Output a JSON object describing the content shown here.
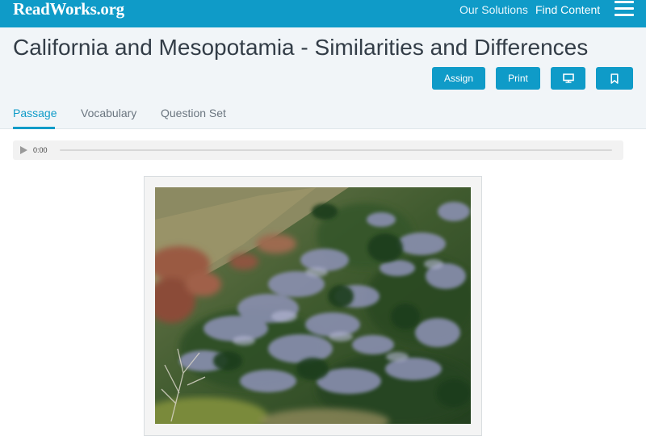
{
  "brand": {
    "logo": "ReadWorks.org"
  },
  "nav": {
    "our_solutions": "Our Solutions",
    "find_content": "Find Content"
  },
  "article": {
    "title": "California and Mesopotamia - Similarities and Differences"
  },
  "actions": {
    "assign": "Assign",
    "print": "Print",
    "present_icon": "monitor-icon",
    "bookmark_icon": "bookmark-icon"
  },
  "tabs": [
    {
      "label": "Passage",
      "active": true
    },
    {
      "label": "Vocabulary",
      "active": false
    },
    {
      "label": "Question Set",
      "active": false
    }
  ],
  "audio": {
    "time": "0:00",
    "progress": 0
  },
  "colors": {
    "brand": "#0f9bc8",
    "title": "#333d47",
    "header_bg": "#f1f5f8"
  }
}
